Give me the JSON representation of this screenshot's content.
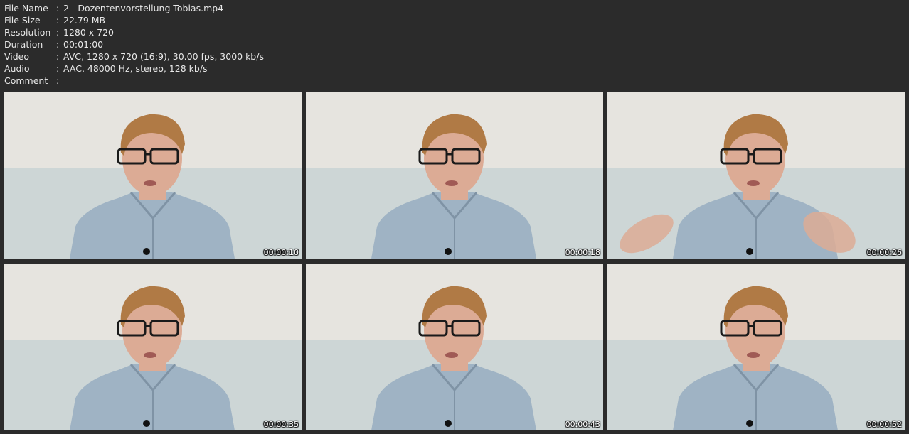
{
  "info": {
    "rows": [
      {
        "key": "File Name",
        "value": "2 - Dozentenvorstellung Tobias.mp4"
      },
      {
        "key": "File Size",
        "value": "22.79 MB"
      },
      {
        "key": "Resolution",
        "value": "1280 x 720"
      },
      {
        "key": "Duration",
        "value": "00:01:00"
      },
      {
        "key": "Video",
        "value": "AVC, 1280 x 720 (16:9), 30.00 fps, 3000 kb/s"
      },
      {
        "key": "Audio",
        "value": "AAC, 48000 Hz, stereo, 128 kb/s"
      },
      {
        "key": "Comment",
        "value": ""
      }
    ],
    "separator": ":"
  },
  "thumbnails": [
    {
      "timestamp": "00:00:10",
      "gesture": false
    },
    {
      "timestamp": "00:00:18",
      "gesture": false
    },
    {
      "timestamp": "00:00:26",
      "gesture": true
    },
    {
      "timestamp": "00:00:35",
      "gesture": false
    },
    {
      "timestamp": "00:00:43",
      "gesture": false
    },
    {
      "timestamp": "00:00:52",
      "gesture": false
    }
  ],
  "colors": {
    "background": "#2b2b2b",
    "wall_top": "#e6e4df",
    "wall_bottom": "#cdd6d6",
    "hair": "#b07a45",
    "skin": "#dcab95",
    "shirt": "#9fb3c4"
  }
}
